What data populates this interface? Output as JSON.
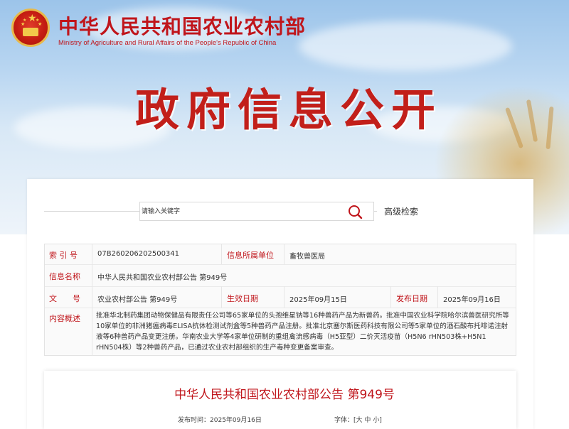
{
  "header": {
    "ministry_cn": "中华人民共和国农业农村部",
    "ministry_en": "Ministry of Agriculture and Rural Affairs of the People's Republic of China",
    "banner_title": "政府信息公开"
  },
  "search": {
    "placeholder": "请输入关键字",
    "advanced_label": "高级检索"
  },
  "meta": {
    "index_label": "索 引 号",
    "index_value": "07B260206202500341",
    "org_label": "信息所属单位",
    "org_value": "畜牧兽医局",
    "name_label": "信息名称",
    "name_value": "中华人民共和国农业农村部公告 第949号",
    "doc_label": "文　　号",
    "doc_value": "农业农村部公告 第949号",
    "effective_label": "生效日期",
    "effective_value": "2025年09月15日",
    "publish_label": "发布日期",
    "publish_value": "2025年09月16日",
    "summary_label": "内容概述",
    "summary_value": "批准华北制药集团动物保健品有限责任公司等65家单位的头孢维星钠等16种兽药产品为新兽药。批准中国农业科学院哈尔滨兽医研究所等10家单位的非洲猪瘟病毒ELISA抗体检测试剂盒等5种兽药产品注册。批准北京塞尔斯医药科技有限公司等5家单位的酒石酸布托啡诺注射液等6种兽药产品变更注册。华南农业大学等4家单位研制的重组禽流感病毒（H5亚型）二价灭活疫苗（H5N6 rHN503株+H5N1 rHN504株）等2种兽药产品，已通过农业农村部组织的生产毒种变更备案审查。"
  },
  "article": {
    "title": "中华人民共和国农业农村部公告 第949号",
    "publish_time_label": "发布时间：",
    "publish_time_value": "2025年09月16日",
    "font_label": "字体：",
    "font_open": "[",
    "font_large": "大",
    "font_medium": "中",
    "font_small": "小",
    "font_close": "]"
  },
  "colors": {
    "brand_red": "#c0151b",
    "sky_blue": "#9cc4ea"
  },
  "icons": {
    "emblem": "national-emblem-icon",
    "search": "search-icon"
  }
}
